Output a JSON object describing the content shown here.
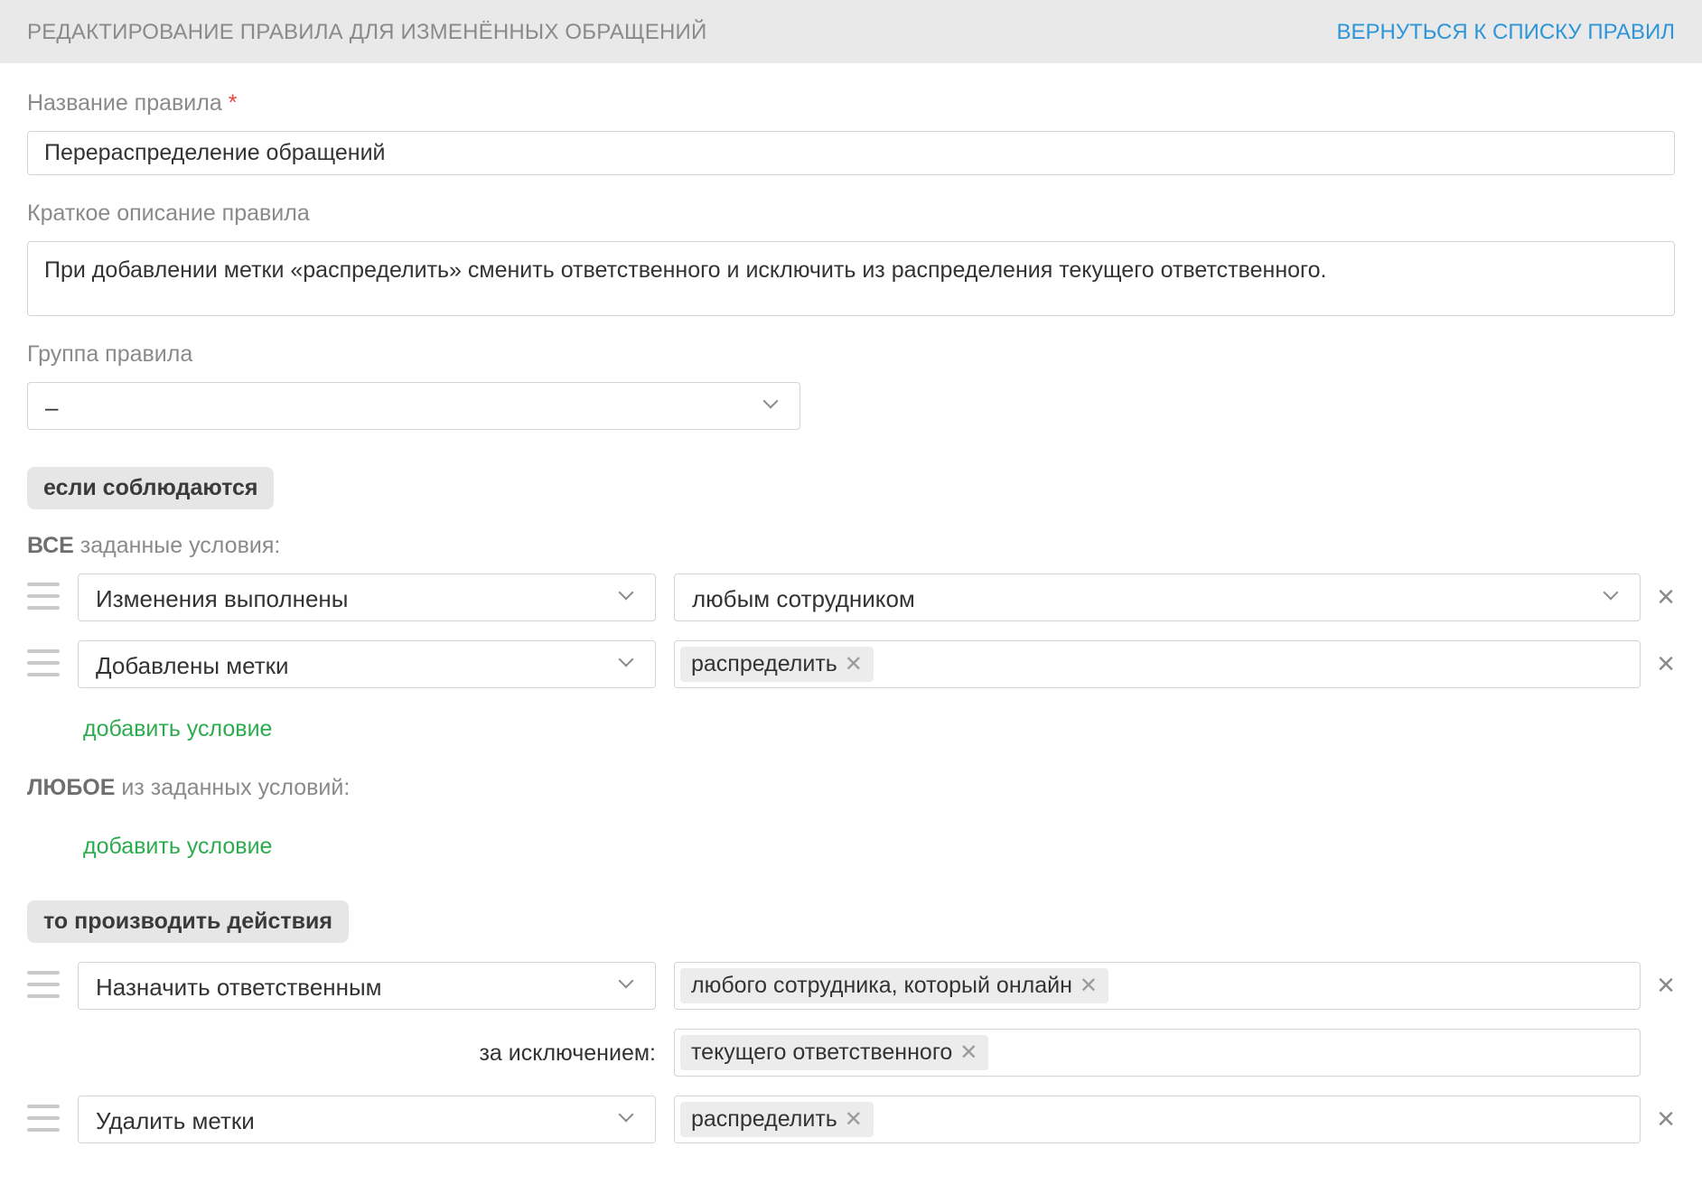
{
  "header": {
    "title": "РЕДАКТИРОВАНИЕ ПРАВИЛА ДЛЯ ИЗМЕНЁННЫХ ОБРАЩЕНИЙ",
    "back_link": "ВЕРНУТЬСЯ К СПИСКУ ПРАВИЛ"
  },
  "form": {
    "name_label": "Название правила",
    "required_mark": "*",
    "name_value": "Перераспределение обращений",
    "description_label": "Краткое описание правила",
    "description_value": "При добавлении метки «распределить» сменить ответственного и исключить из распределения текущего ответственного.",
    "group_label": "Группа правила",
    "group_value": "–"
  },
  "conditions": {
    "if_label": "если соблюдаются",
    "all_strong": "ВСЕ",
    "all_text": " заданные условия:",
    "all_rows": [
      {
        "field": "Изменения выполнены",
        "value": "любым сотрудником"
      },
      {
        "field": "Добавлены метки",
        "tags": [
          "распределить"
        ]
      }
    ],
    "add_condition": "добавить условие",
    "any_strong": "ЛЮБОЕ",
    "any_text": " из заданных условий:"
  },
  "actions": {
    "then_label": "то производить действия",
    "rows": [
      {
        "field": "Назначить ответственным",
        "tags": [
          "любого сотрудника, который онлайн"
        ],
        "except_label": "за исключением:",
        "except_tags": [
          "текущего ответственного"
        ]
      },
      {
        "field": "Удалить метки",
        "tags": [
          "распределить"
        ]
      }
    ]
  },
  "icons": {
    "remove": "close-icon",
    "tag_remove": "tag-remove-icon",
    "drag": "drag-handle-icon",
    "chevron": "chevron-down-icon"
  },
  "colors": {
    "header_bg": "#e9e9e9",
    "link_blue": "#2d95d8",
    "add_green": "#2dab4f",
    "required_red": "#e8443a"
  }
}
